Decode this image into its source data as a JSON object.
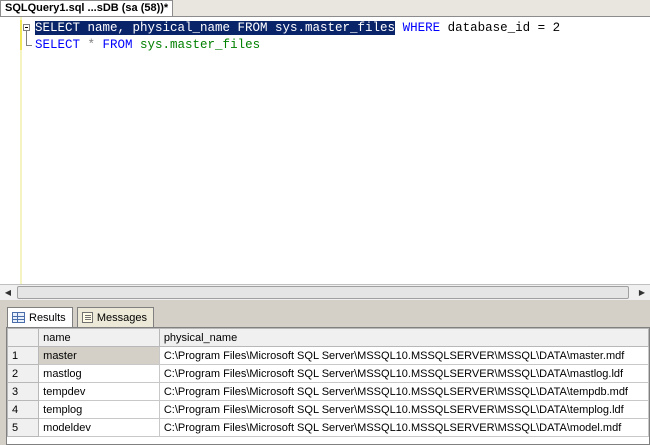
{
  "document_tab": {
    "title": "SQLQuery1.sql ...sDB (sa (58))*"
  },
  "editor": {
    "line1": {
      "selected_text": "SELECT name, physical_name FROM sys.master_files",
      "kw_where": "WHERE",
      "rest": " database_id = 2"
    },
    "line2": {
      "kw_select": "SELECT",
      "op_star": " * ",
      "kw_from": "FROM",
      "obj": " sys.master_files"
    }
  },
  "results_tabs": [
    {
      "label": "Results",
      "icon": "grid-icon",
      "active": true
    },
    {
      "label": "Messages",
      "icon": "messages-icon",
      "active": false
    }
  ],
  "results_grid": {
    "columns": [
      "",
      "name",
      "physical_name"
    ],
    "rows": [
      {
        "num": "1",
        "name": "master",
        "physical_name": "C:\\Program Files\\Microsoft SQL Server\\MSSQL10.MSSQLSERVER\\MSSQL\\DATA\\master.mdf"
      },
      {
        "num": "2",
        "name": "mastlog",
        "physical_name": "C:\\Program Files\\Microsoft SQL Server\\MSSQL10.MSSQLSERVER\\MSSQL\\DATA\\mastlog.ldf"
      },
      {
        "num": "3",
        "name": "tempdev",
        "physical_name": "C:\\Program Files\\Microsoft SQL Server\\MSSQL10.MSSQLSERVER\\MSSQL\\DATA\\tempdb.mdf"
      },
      {
        "num": "4",
        "name": "templog",
        "physical_name": "C:\\Program Files\\Microsoft SQL Server\\MSSQL10.MSSQLSERVER\\MSSQL\\DATA\\templog.ldf"
      },
      {
        "num": "5",
        "name": "modeldev",
        "physical_name": "C:\\Program Files\\Microsoft SQL Server\\MSSQL10.MSSQLSERVER\\MSSQL\\DATA\\model.mdf"
      }
    ]
  },
  "colors": {
    "keyword": "#0000ff",
    "object": "#008000",
    "selection": "#0a246a"
  }
}
